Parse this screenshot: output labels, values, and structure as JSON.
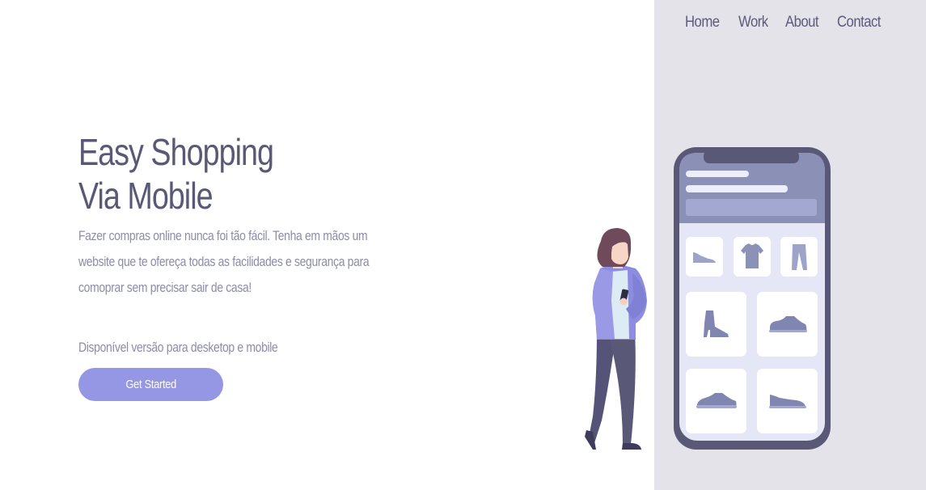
{
  "nav": {
    "items": [
      {
        "label": "Home"
      },
      {
        "label": "Work"
      },
      {
        "label": "About"
      },
      {
        "label": "Contact"
      }
    ]
  },
  "hero": {
    "title_line1": "Easy Shopping",
    "title_line2": "Via Mobile",
    "description": "Fazer compras online nunca foi tão fácil. Tenha em mãos um website que te ofereça todas as facilidades e segurança para comoprar sem precisar sair de casa!",
    "availability": "Disponível versão para desketop e mobile",
    "cta_label": "Get Started"
  },
  "colors": {
    "accent": "#9597e4",
    "text_dark": "#5a5877",
    "text_muted": "#8d8ca5",
    "panel_bg": "#e4e3ea"
  },
  "illustration": {
    "phone_products": [
      "shoe-icon",
      "tshirt-icon",
      "pants-icon",
      "boot-icon",
      "sneaker-icon",
      "sneaker-icon",
      "sneaker-icon"
    ],
    "person": "woman-with-phone"
  }
}
